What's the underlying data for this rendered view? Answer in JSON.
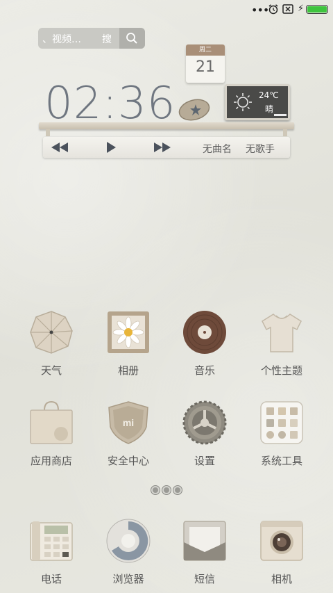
{
  "status_bar": {
    "more_icon": "ellipsis-icon",
    "charging_icon": "bolt-icon",
    "battery_color": "#3ec43e"
  },
  "search": {
    "placeholder": "、视频…",
    "go_label": "搜"
  },
  "calendar": {
    "weekday": "周二",
    "day": "21"
  },
  "clock": {
    "time": "02:36"
  },
  "weather": {
    "temperature": "24℃",
    "condition": "晴"
  },
  "music": {
    "song": "无曲名",
    "artist": "无歌手"
  },
  "apps": [
    {
      "label": "天气",
      "icon": "umbrella-icon"
    },
    {
      "label": "相册",
      "icon": "flower-photo-icon"
    },
    {
      "label": "音乐",
      "icon": "vinyl-record-icon"
    },
    {
      "label": "个性主题",
      "icon": "tshirt-icon"
    },
    {
      "label": "应用商店",
      "icon": "shopping-bag-icon"
    },
    {
      "label": "安全中心",
      "icon": "shield-icon"
    },
    {
      "label": "设置",
      "icon": "gear-icon"
    },
    {
      "label": "系统工具",
      "icon": "tools-folder-icon"
    }
  ],
  "dock": [
    {
      "label": "电话",
      "icon": "telephone-icon"
    },
    {
      "label": "浏览器",
      "icon": "browser-icon"
    },
    {
      "label": "短信",
      "icon": "envelope-icon"
    },
    {
      "label": "相机",
      "icon": "camera-icon"
    }
  ],
  "pages": {
    "count": 3,
    "active": 1
  }
}
